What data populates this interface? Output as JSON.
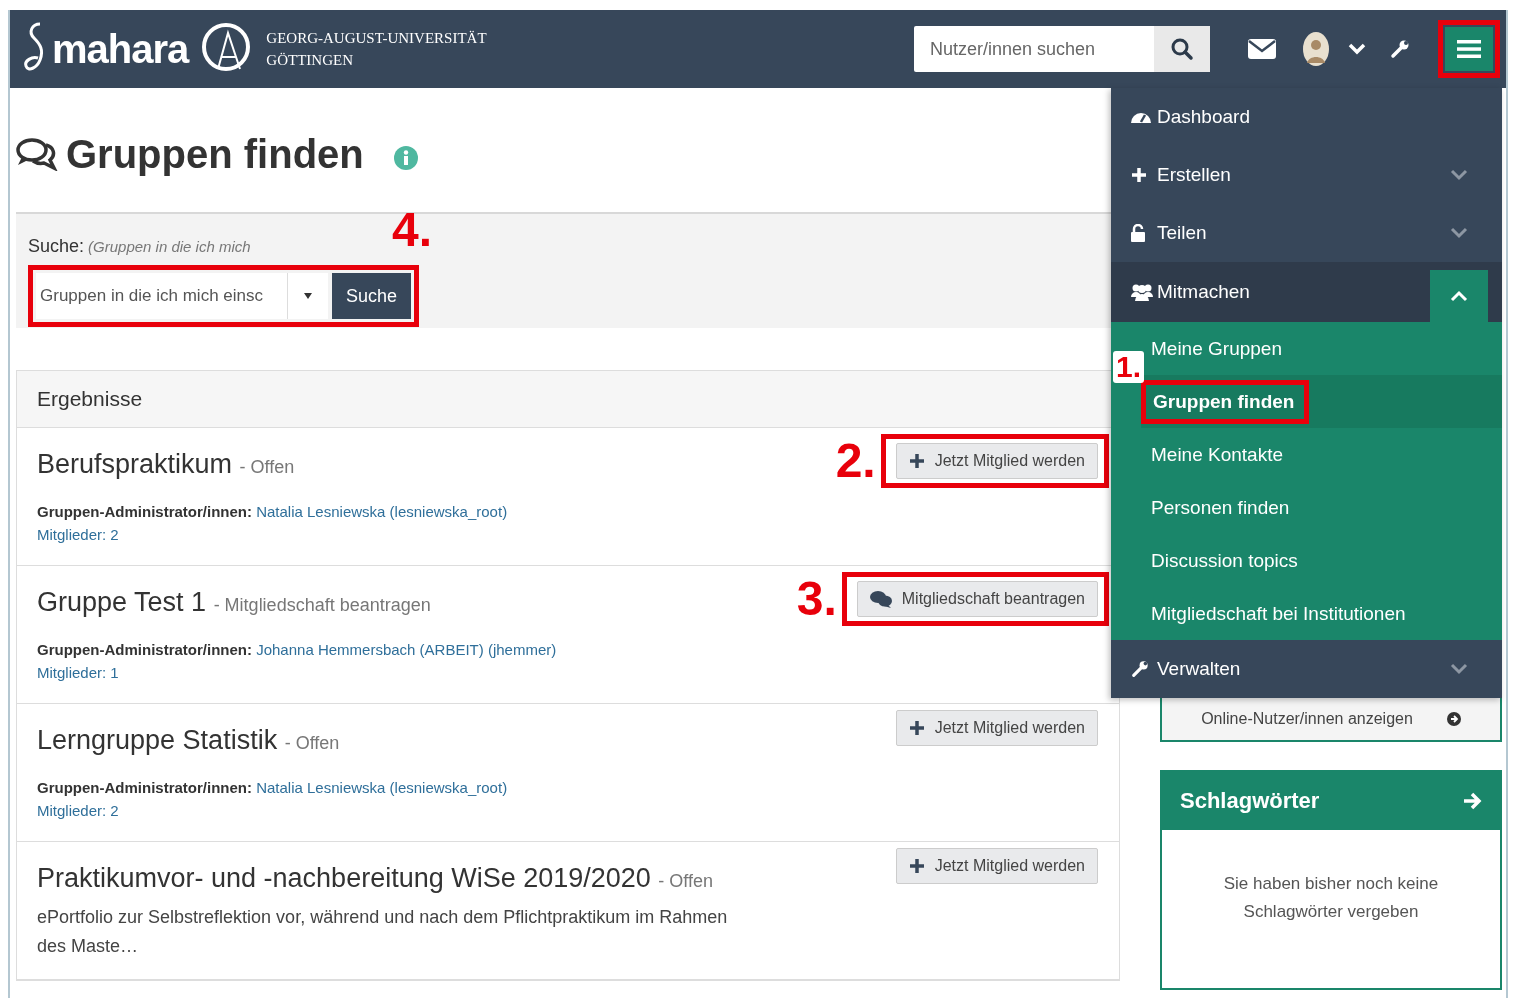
{
  "header": {
    "logo": "mahara",
    "university": [
      "GEORG-AUGUST-UNIVERSITÄT",
      "GÖTTINGEN"
    ],
    "search": {
      "placeholder": "Nutzer/innen suchen"
    },
    "menu_button": {
      "highlighted": true
    }
  },
  "page_title": "Gruppen finden",
  "search": {
    "label": "Suche:",
    "hint": "(Gruppen in die ich mich",
    "filter_value": "Gruppen in die ich mich einsc",
    "button": "Suche",
    "highlighted": true,
    "marker": "4."
  },
  "results": {
    "heading": "Ergebnisse",
    "groups": [
      {
        "name": "Berufspraktikum",
        "status": "- Offen",
        "admin_label": "Gruppen-Administrator/innen:",
        "admin": "Natalia Lesniewska (lesniewska_root)",
        "members": "Mitglieder: 2",
        "action": {
          "kind": "join",
          "label": "Jetzt Mitglied werden",
          "highlighted": true,
          "marker": "2."
        }
      },
      {
        "name": "Gruppe Test 1",
        "status": "- Mitgliedschaft beantragen",
        "admin_label": "Gruppen-Administrator/innen:",
        "admin": "Johanna Hemmersbach (ARBEIT) (jhemmer)",
        "members": "Mitglieder: 1",
        "action": {
          "kind": "request",
          "label": "Mitgliedschaft beantragen",
          "highlighted": true,
          "marker": "3."
        }
      },
      {
        "name": "Lerngruppe Statistik",
        "status": "- Offen",
        "admin_label": "Gruppen-Administrator/innen:",
        "admin": "Natalia Lesniewska (lesniewska_root)",
        "members": "Mitglieder: 2",
        "action": {
          "kind": "join",
          "label": "Jetzt Mitglied werden",
          "highlighted": false
        }
      },
      {
        "name": "Praktikumvor- und -nachbereitung WiSe 2019/2020",
        "status": "- Offen",
        "description": "ePortfolio zur Selbstreflektion vor, während und nach dem Pflichtpraktikum im Rahmen des Maste…",
        "action": {
          "kind": "join",
          "label": "Jetzt Mitglied werden",
          "highlighted": false
        }
      }
    ]
  },
  "sidebar": {
    "online_button": "Online-Nutzer/innen anzeigen",
    "tags": {
      "title": "Schlagwörter",
      "empty_text": "Sie haben bisher noch keine Schlagwörter vergeben"
    }
  },
  "menu": [
    {
      "kind": "dashboard",
      "label": "Dashboard",
      "expandable": false,
      "expanded": false
    },
    {
      "kind": "create",
      "label": "Erstellen",
      "expandable": true,
      "expanded": false
    },
    {
      "kind": "share",
      "label": "Teilen",
      "expandable": true,
      "expanded": false
    },
    {
      "kind": "engage",
      "label": "Mitmachen",
      "expandable": true,
      "expanded": true,
      "children": [
        {
          "label": "Meine Gruppen",
          "selected": false
        },
        {
          "label": "Gruppen finden",
          "selected": true,
          "highlighted": true,
          "marker": "1."
        },
        {
          "label": "Meine Kontakte",
          "selected": false
        },
        {
          "label": "Personen finden",
          "selected": false
        },
        {
          "label": "Discussion topics",
          "selected": false
        },
        {
          "label": "Mitgliedschaft bei Institutionen",
          "selected": false
        }
      ]
    },
    {
      "kind": "manage",
      "label": "Verwalten",
      "expandable": true,
      "expanded": false
    }
  ]
}
